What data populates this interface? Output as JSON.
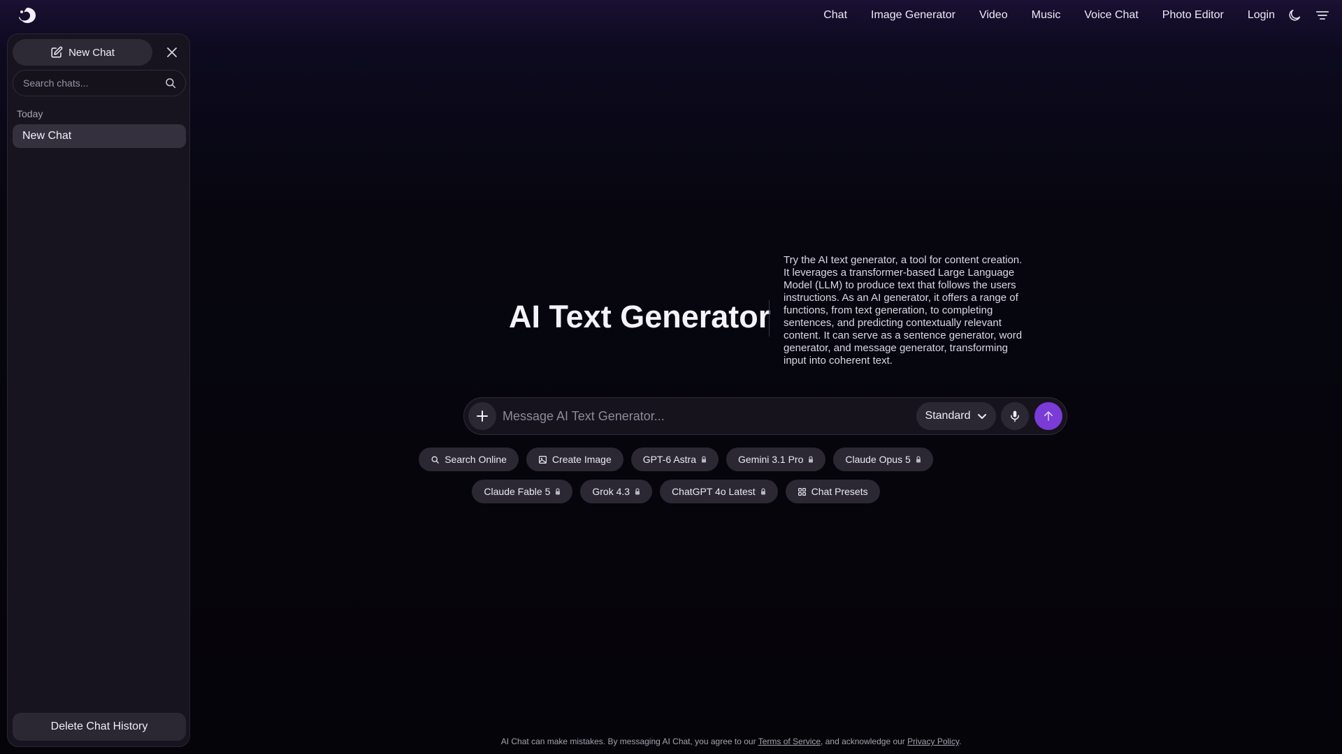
{
  "nav": {
    "items": [
      "Chat",
      "Image Generator",
      "Video",
      "Music",
      "Voice Chat",
      "Photo Editor"
    ],
    "login": "Login"
  },
  "sidebar": {
    "new_chat_label": "New Chat",
    "search_placeholder": "Search chats...",
    "section_today": "Today",
    "chats": [
      "New Chat"
    ],
    "delete_label": "Delete Chat History"
  },
  "hero": {
    "title": "AI Text Generator",
    "description": "Try the AI text generator, a tool for content creation. It leverages a transformer-based Large Language Model (LLM) to produce text that follows the users instructions. As an AI generator, it offers a range of functions, from text generation, to completing sentences, and predicting contextually relevant content. It can serve as a sentence generator, word generator, and message generator, transforming input into coherent text."
  },
  "composer": {
    "placeholder": "Message AI Text Generator...",
    "mode": "Standard"
  },
  "chips": {
    "search_online": "Search Online",
    "create_image": "Create Image",
    "gpt6": "GPT-6 Astra",
    "gemini": "Gemini 3.1 Pro",
    "claude_opus": "Claude Opus 5",
    "claude_fable": "Claude Fable 5",
    "grok": "Grok 4.3",
    "chatgpt4o": "ChatGPT 4o Latest",
    "chat_presets": "Chat Presets"
  },
  "footer": {
    "text1": "AI Chat can make mistakes. By messaging AI Chat, you agree to our ",
    "terms": "Terms of Service",
    "text2": ", and acknowledge our ",
    "privacy": "Privacy Policy",
    "text3": "."
  },
  "colors": {
    "accent": "#7a3bd6",
    "chip_bg": "#2b2833",
    "sidebar_bg": "#17141f"
  }
}
